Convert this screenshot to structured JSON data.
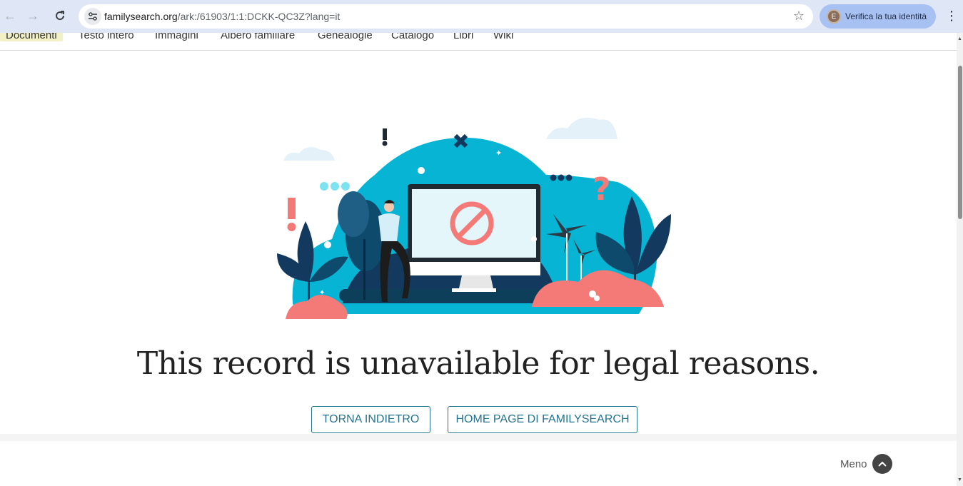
{
  "browser": {
    "url_host": "familysearch.org",
    "url_path": "/ark:/61903/1:1:DCKK-QC3Z?lang=it",
    "profile_label": "Verifica la tua identità",
    "profile_initial": "E"
  },
  "nav": {
    "items": [
      {
        "label": "Documenti"
      },
      {
        "label": "Testo intero"
      },
      {
        "label": "Immagini"
      },
      {
        "label": "Albero familiare"
      },
      {
        "label": "Genealogie"
      },
      {
        "label": "Catalogo"
      },
      {
        "label": "Libri"
      },
      {
        "label": "Wiki"
      }
    ]
  },
  "main": {
    "headline": "This record is unavailable for legal reasons.",
    "back_button": "TORNA INDIETRO",
    "home_button": "HOME PAGE DI FAMILYSEARCH"
  },
  "footer": {
    "less_label": "Meno"
  },
  "colors": {
    "accent": "#24748d",
    "illustration_teal": "#08b4d4",
    "illustration_navy": "#133a5e",
    "illustration_coral": "#f47a78"
  }
}
